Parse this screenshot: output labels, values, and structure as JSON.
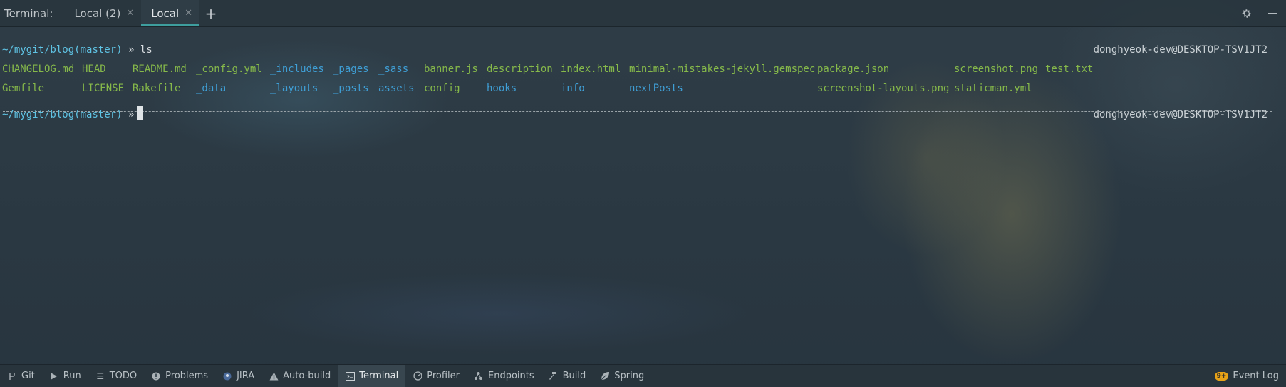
{
  "header": {
    "label": "Terminal:",
    "tabs": [
      {
        "label": "Local (2)",
        "active": false
      },
      {
        "label": "Local",
        "active": true
      }
    ],
    "new_tab_icon": "plus-icon",
    "settings_icon": "gear-icon",
    "hide_icon": "minimize-icon"
  },
  "terminal": {
    "prompt1": {
      "path": "~/mygit/blog",
      "branch_open": "(",
      "branch": "master",
      "branch_close": ")",
      "arrow": "»",
      "command": "ls"
    },
    "rprompt": "donghyeok-dev@DESKTOP-TSV1JT2",
    "ls_rows": [
      [
        "CHANGELOG.md",
        "HEAD",
        "README.md",
        "_config.yml",
        "_includes",
        "_pages",
        "_sass",
        "banner.js",
        "description",
        "index.html",
        "minimal-mistakes-jekyll.gemspec",
        "package.json",
        "screenshot.png",
        "test.txt"
      ],
      [
        "Gemfile",
        "LICENSE",
        "Rakefile",
        "_data",
        "_layouts",
        "_posts",
        "assets",
        "config",
        "hooks",
        "info",
        "nextPosts",
        "",
        "screenshot-layouts.png",
        "staticman.yml"
      ]
    ],
    "prompt2": {
      "path": "~/mygit/blog",
      "branch_open": "(",
      "branch": "master",
      "branch_close": ")",
      "arrow": "»"
    }
  },
  "colors": {
    "file": "#86b94a",
    "directory": "#3f9fd6",
    "prompt_path": "#5fc3e4",
    "accent": "#3e9e9e"
  },
  "toolbar": {
    "items": [
      {
        "label": "Git",
        "icon": "git-branch-icon"
      },
      {
        "label": "Run",
        "icon": "play-icon"
      },
      {
        "label": "TODO",
        "icon": "list-icon"
      },
      {
        "label": "Problems",
        "icon": "alert-circle-icon"
      },
      {
        "label": "JIRA",
        "icon": "jira-icon"
      },
      {
        "label": "Auto-build",
        "icon": "warning-triangle-icon"
      },
      {
        "label": "Terminal",
        "icon": "terminal-icon",
        "active": true
      },
      {
        "label": "Profiler",
        "icon": "profiler-icon"
      },
      {
        "label": "Endpoints",
        "icon": "endpoints-icon"
      },
      {
        "label": "Build",
        "icon": "hammer-icon"
      },
      {
        "label": "Spring",
        "icon": "leaf-icon"
      }
    ],
    "event_log": {
      "label": "Event Log",
      "badge": "9+"
    }
  }
}
